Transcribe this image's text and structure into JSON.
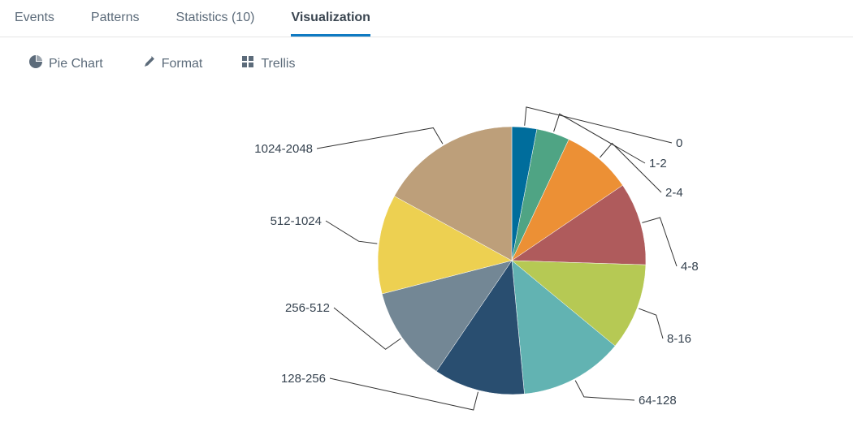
{
  "tabs": {
    "events": "Events",
    "patterns": "Patterns",
    "statistics": "Statistics (10)",
    "visualization": "Visualization",
    "active": "visualization"
  },
  "toolbar": {
    "pie_chart": "Pie Chart",
    "format": "Format",
    "trellis": "Trellis"
  },
  "chart_data": {
    "type": "pie",
    "title": "",
    "slices": [
      {
        "label": "0",
        "value": 3.0,
        "color": "#006d9c"
      },
      {
        "label": "1-2",
        "value": 4.0,
        "color": "#4fa484"
      },
      {
        "label": "2-4",
        "value": 8.5,
        "color": "#ec9035"
      },
      {
        "label": "4-8",
        "value": 10.0,
        "color": "#af5b5c"
      },
      {
        "label": "8-16",
        "value": 10.5,
        "color": "#b6c954"
      },
      {
        "label": "64-128",
        "value": 12.5,
        "color": "#62b3b2"
      },
      {
        "label": "128-256",
        "value": 11.0,
        "color": "#294e70"
      },
      {
        "label": "256-512",
        "value": 11.5,
        "color": "#738795"
      },
      {
        "label": "512-1024",
        "value": 12.0,
        "color": "#edd051"
      },
      {
        "label": "1024-2048",
        "value": 17.0,
        "color": "#bd9f7a"
      }
    ]
  }
}
